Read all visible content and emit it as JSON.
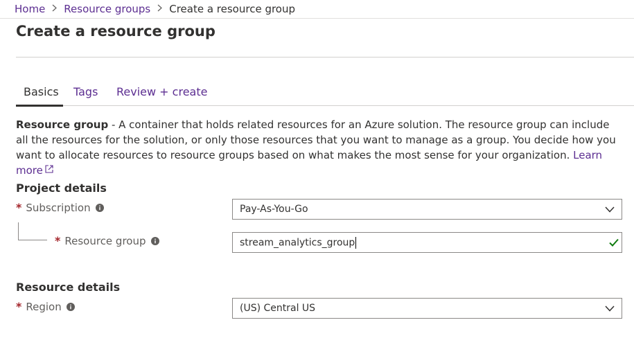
{
  "breadcrumb": {
    "home": "Home",
    "resource_groups": "Resource groups",
    "current": "Create a resource group"
  },
  "page": {
    "title": "Create a resource group"
  },
  "tabs": [
    {
      "label": "Basics",
      "active": true
    },
    {
      "label": "Tags",
      "active": false
    },
    {
      "label": "Review + create",
      "active": false
    }
  ],
  "description": {
    "term": "Resource group",
    "text": " - A container that holds related resources for an Azure solution. The resource group can include all the resources for the solution, or only those resources that you want to manage as a group. You decide how you want to allocate resources to resource groups based on what makes the most sense for your organization. ",
    "learn_more": "Learn more"
  },
  "project_details": {
    "title": "Project details",
    "subscription": {
      "label": "Subscription",
      "value": "Pay-As-You-Go"
    },
    "resource_group": {
      "label": "Resource group",
      "value": "stream_analytics_group"
    }
  },
  "resource_details": {
    "title": "Resource details",
    "region": {
      "label": "Region",
      "value": "(US) Central US"
    }
  },
  "required_marker": "*",
  "icons": {
    "chevron": "chevron-down-icon",
    "info": "info-icon",
    "valid": "checkmark-icon",
    "external": "external-link-icon"
  },
  "colors": {
    "link": "#5c2e91",
    "required": "#a4262c",
    "valid": "#107c10",
    "text": "#323130"
  }
}
